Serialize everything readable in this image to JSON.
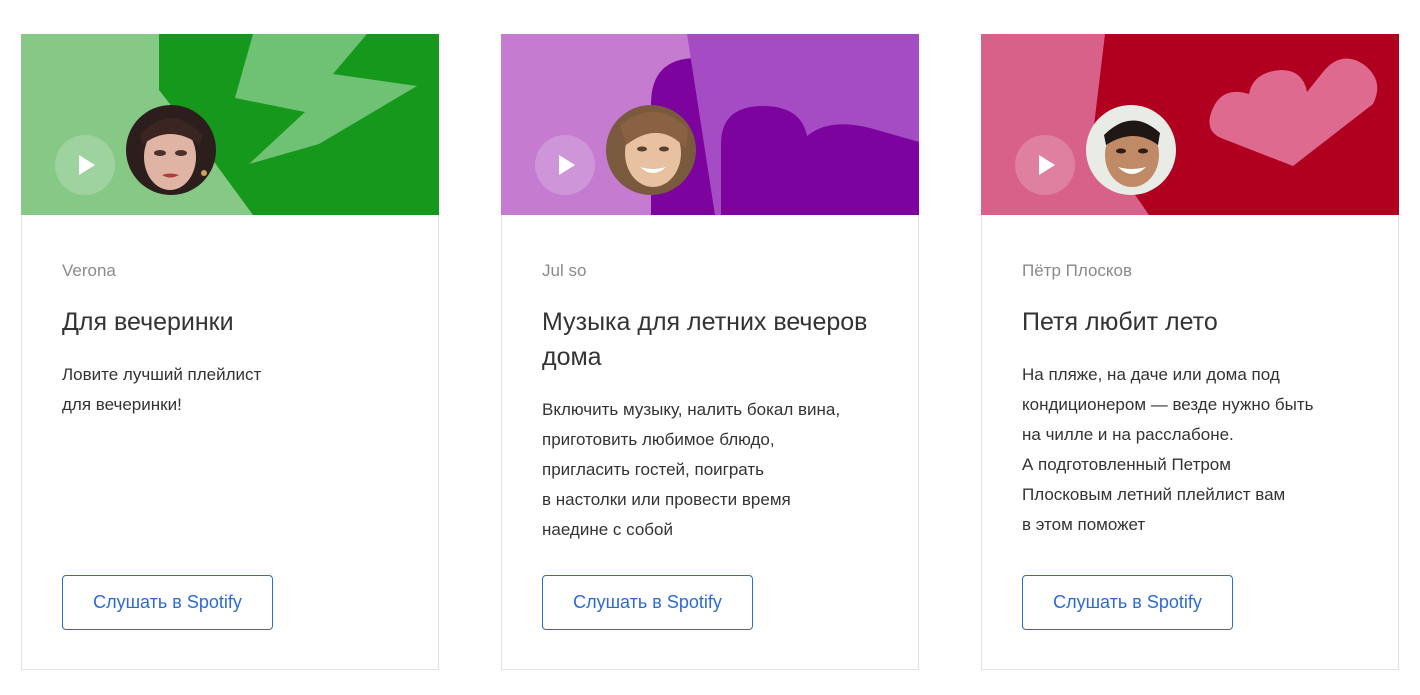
{
  "colors": {
    "card_border": "#e3e3e3",
    "author_text": "#8a8a8a",
    "body_text": "#333333",
    "button_accent": "#2c6ad6"
  },
  "cards": [
    {
      "author": "Verona",
      "title": "Для вечеринки",
      "description": [
        "Ловите лучший плейлист",
        "для вечеринки!"
      ],
      "button_label": "Слушать в Spotify",
      "cover_theme": "green-lightning",
      "colors": {
        "base": "#86c987",
        "accent": "#16981c",
        "shape": "#6fc173"
      }
    },
    {
      "author": "Jul so",
      "title": "Музыка для летних вечеров дома",
      "description": [
        "Включить музыку, налить бокал вина,",
        "приготовить любимое блюдо,",
        "пригласить гостей, поиграть",
        "в настолки или провести время",
        "наедине с собой"
      ],
      "button_label": "Слушать в Spotify",
      "cover_theme": "purple-note",
      "colors": {
        "base": "#c47bd0",
        "accent": "#7d039e",
        "shape": "#a54cc4"
      }
    },
    {
      "author": "Пётр Плосков",
      "title": "Петя любит лето",
      "description": [
        "На пляже, на даче или дома под",
        "кондиционером — везде нужно быть",
        "на чилле и на расслабоне.",
        "А подготовленный Петром",
        "Плосковым летний плейлист вам",
        "в этом поможет"
      ],
      "button_label": "Слушать в Spotify",
      "cover_theme": "red-heart",
      "colors": {
        "base": "#d8618a",
        "accent": "#b1001f",
        "shape": "#de6a8f"
      }
    }
  ]
}
